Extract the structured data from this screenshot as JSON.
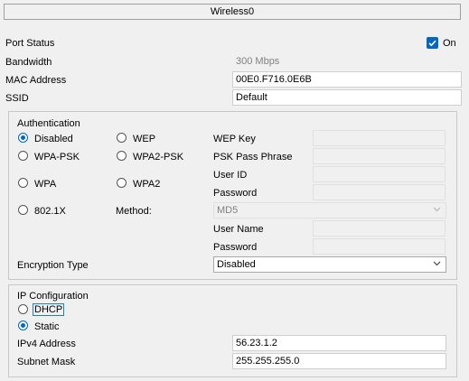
{
  "header": {
    "title": "Wireless0"
  },
  "port_status": {
    "label": "Port Status",
    "toggle_label": "On",
    "checked": true
  },
  "bandwidth": {
    "label": "Bandwidth",
    "value": "300 Mbps"
  },
  "mac_address": {
    "label": "MAC Address",
    "value": "00E0.F716.0E6B"
  },
  "ssid": {
    "label": "SSID",
    "value": "Default"
  },
  "authentication": {
    "title": "Authentication",
    "options": {
      "disabled": "Disabled",
      "wep": "WEP",
      "wpa_psk": "WPA-PSK",
      "wpa2_psk": "WPA2-PSK",
      "wpa": "WPA",
      "wpa2": "WPA2",
      "dot1x": "802.1X"
    },
    "selected": "Disabled",
    "wep_key_label": "WEP Key",
    "psk_label": "PSK Pass Phrase",
    "user_id_label": "User ID",
    "password_label": "Password",
    "method_label": "Method:",
    "method_value": "MD5",
    "user_name_label": "User Name",
    "password2_label": "Password",
    "encryption_label": "Encryption Type",
    "encryption_value": "Disabled"
  },
  "ip_config": {
    "title": "IP Configuration",
    "dhcp_label": "DHCP",
    "static_label": "Static",
    "selected": "Static",
    "ipv4_label": "IPv4 Address",
    "ipv4_value": "56.23.1.2",
    "subnet_label": "Subnet Mask",
    "subnet_value": "255.255.255.0"
  },
  "colors": {
    "accent": "#0067c0",
    "background": "#f0f0f0"
  },
  "icons": [
    "checkbox-checked-icon",
    "chevron-down-icon",
    "radio-selected-icon"
  ]
}
